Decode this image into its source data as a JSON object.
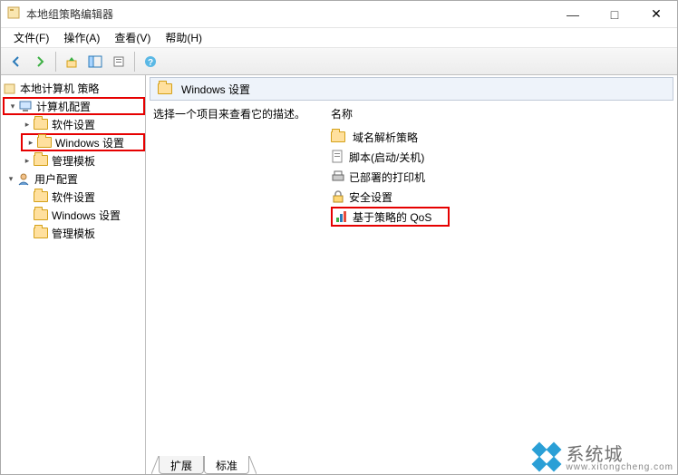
{
  "window": {
    "title": "本地组策略编辑器",
    "controls": {
      "min": "—",
      "max": "□",
      "close": "✕"
    }
  },
  "menu": {
    "file": "文件(F)",
    "action": "操作(A)",
    "view": "查看(V)",
    "help": "帮助(H)"
  },
  "tree": {
    "root": "本地计算机 策略",
    "computer_config": "计算机配置",
    "software_settings": "软件设置",
    "windows_settings": "Windows 设置",
    "admin_templates": "管理模板",
    "user_config": "用户配置",
    "user_software": "软件设置",
    "user_windows": "Windows 设置",
    "user_admin": "管理模板"
  },
  "content": {
    "header_title": "Windows 设置",
    "instruction": "选择一个项目来查看它的描述。",
    "name_col": "名称",
    "items": {
      "dns": "域名解析策略",
      "scripts": "脚本(启动/关机)",
      "printers": "已部署的打印机",
      "security": "安全设置",
      "qos": "基于策略的 QoS"
    }
  },
  "tabs": {
    "extended": "扩展",
    "standard": "标准"
  },
  "watermark": {
    "text": "系统城",
    "url": "www.xitongcheng.com"
  }
}
